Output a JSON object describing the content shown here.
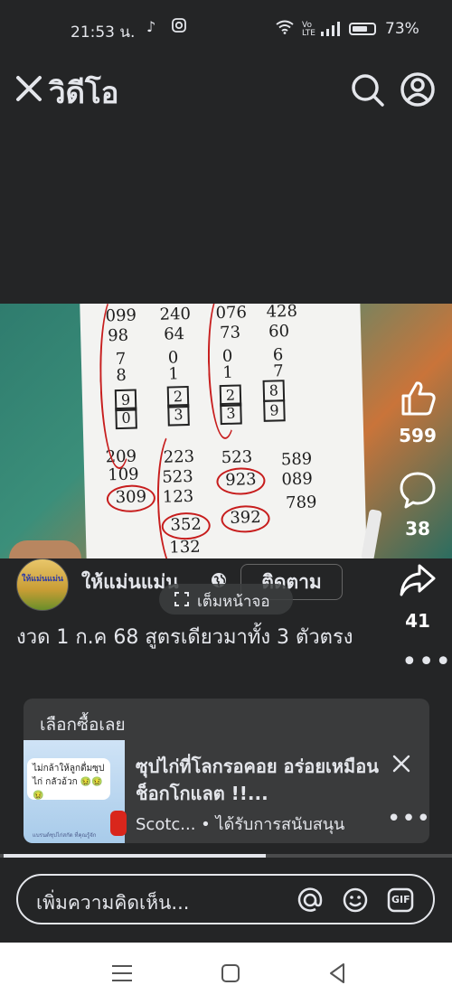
{
  "status_bar": {
    "time": "21:53 น.",
    "battery": "73%",
    "battery_level": 0.73,
    "network": "4G"
  },
  "header": {
    "title": "วิดีโอ",
    "icons": [
      "close-icon",
      "search-icon",
      "profile-icon"
    ]
  },
  "video": {
    "fullscreen_label": "เต็มหน้าจอ",
    "progress": 0.59,
    "paper_numbers": {
      "top_rows": [
        "099",
        "240",
        "076",
        "428",
        "98",
        "64",
        "73",
        "60",
        "7",
        "0",
        "0",
        "6",
        "8",
        "1",
        "1",
        "7"
      ],
      "boxed": [
        "9",
        "0",
        "2",
        "3",
        "2",
        "3",
        "8",
        "9"
      ],
      "middle": [
        "209",
        "223",
        "523",
        "589",
        "109",
        "523",
        "923",
        "089",
        "309",
        "123",
        "789",
        "352",
        "392",
        "132"
      ]
    }
  },
  "actions": {
    "likes": "599",
    "comments": "38",
    "shares": "41"
  },
  "post": {
    "page_name": "ให้แม่นแม่น",
    "follow_label": "ติดตาม",
    "avatar_text": "ให้แม่นแม่น",
    "caption": "งวด 1 ก.ค 68 สูตรเดียวมาทั้ง 3 ตัวตรง"
  },
  "ad": {
    "header": "เลือกซื้อเลย",
    "thumb_text": "ไม่กล้าให้ลูกดื่มซุปไก่ กลัวอ้วก 🤢🤢🤢",
    "thumb_footer": "แบรนด์ซุปไก่สกัด ที่คุณรู้จัก",
    "title": "ซุปไก่ที่โลกรอคอย อร่อยเหมือนช็อกโกแลต !!...",
    "sponsor": "Scotc... • ได้รับการสนับสนุน"
  },
  "comment_box": {
    "placeholder": "เพิ่มความคิดเห็น...",
    "icons": [
      "mention-icon",
      "emoji-icon",
      "gif-icon"
    ],
    "gif_label": "GIF"
  },
  "navbar": {
    "buttons": [
      "recents-button",
      "home-button",
      "back-button"
    ]
  },
  "colors": {
    "background": "#242526",
    "text": "#e4e6eb",
    "ad_card": "#3a3b3c",
    "pen_red": "#c71d1d"
  }
}
